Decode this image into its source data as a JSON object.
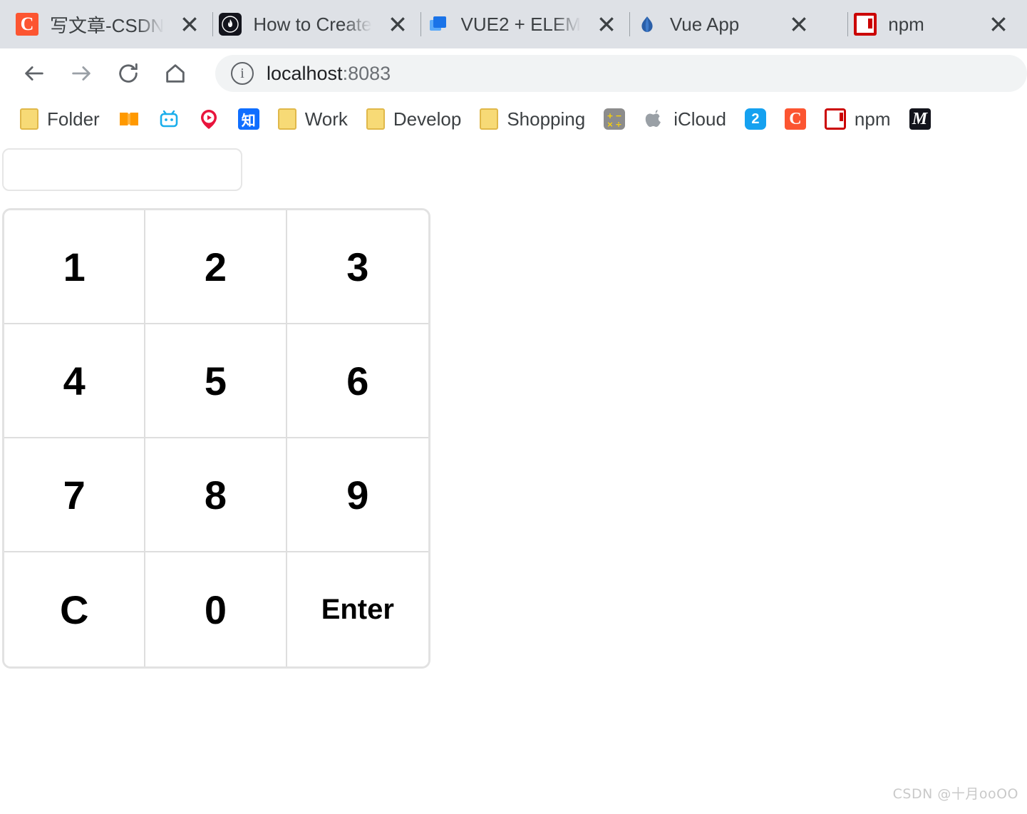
{
  "browser": {
    "tabs": [
      {
        "title": "写文章-CSDN",
        "icon": "csdn-icon",
        "truncated": true,
        "close_label": "×"
      },
      {
        "title": "How to Create",
        "icon": "dark-flame-icon",
        "truncated": true,
        "close_label": "×"
      },
      {
        "title": "VUE2 + ELEM",
        "icon": "blue-squares-icon",
        "truncated": true,
        "close_label": "×"
      },
      {
        "title": "Vue App",
        "icon": "vue-icon",
        "truncated": false,
        "close_label": "×"
      },
      {
        "title": "npm",
        "icon": "npm-icon",
        "truncated": false,
        "close_label": "×"
      }
    ],
    "overflow_tab_icon": "baidu-icon",
    "toolbar": {
      "back_icon": "back-arrow-icon",
      "forward_icon": "forward-arrow-icon",
      "reload_icon": "reload-icon",
      "home_icon": "home-icon",
      "site_info_icon": "info-circle-icon",
      "url_host": "localhost",
      "url_port": ":8083"
    },
    "bookmarks": [
      {
        "label": "Folder",
        "icon": "folder-icon",
        "icon_class": "ico-folder",
        "glyph": ""
      },
      {
        "label": "",
        "icon": "book-icon",
        "icon_class": "ico-book",
        "glyph": ""
      },
      {
        "label": "",
        "icon": "bilibili-icon",
        "icon_class": "ico-bili",
        "glyph": ""
      },
      {
        "label": "",
        "icon": "video-pin-icon",
        "icon_class": "ico-pin",
        "glyph": ""
      },
      {
        "label": "",
        "icon": "zhihu-icon",
        "icon_class": "ico-zhihu",
        "glyph": "知"
      },
      {
        "label": "Work",
        "icon": "folder-icon",
        "icon_class": "ico-folder",
        "glyph": ""
      },
      {
        "label": "Develop",
        "icon": "folder-icon",
        "icon_class": "ico-folder",
        "glyph": ""
      },
      {
        "label": "Shopping",
        "icon": "folder-icon",
        "icon_class": "ico-folder",
        "glyph": ""
      },
      {
        "label": "",
        "icon": "calculator-icon",
        "icon_class": "ico-calc",
        "glyph": ""
      },
      {
        "label": "iCloud",
        "icon": "apple-icon",
        "icon_class": "ico-apple",
        "glyph": ""
      },
      {
        "label": "",
        "icon": "blue-2-icon",
        "icon_class": "ico-blue2",
        "glyph": "2"
      },
      {
        "label": "",
        "icon": "csdn-icon",
        "icon_class": "ico-csdn",
        "glyph": "C"
      },
      {
        "label": "npm",
        "icon": "npm-icon",
        "icon_class": "ico-npm",
        "glyph": ""
      },
      {
        "label": "",
        "icon": "dark-italic-icon",
        "icon_class": "ico-edge",
        "glyph": "M"
      }
    ]
  },
  "app": {
    "input": {
      "value": "",
      "placeholder": ""
    },
    "keypad": {
      "keys": [
        {
          "label": "1",
          "name": "key-1"
        },
        {
          "label": "2",
          "name": "key-2"
        },
        {
          "label": "3",
          "name": "key-3"
        },
        {
          "label": "4",
          "name": "key-4"
        },
        {
          "label": "5",
          "name": "key-5"
        },
        {
          "label": "6",
          "name": "key-6"
        },
        {
          "label": "7",
          "name": "key-7"
        },
        {
          "label": "8",
          "name": "key-8"
        },
        {
          "label": "9",
          "name": "key-9"
        },
        {
          "label": "C",
          "name": "key-clear"
        },
        {
          "label": "0",
          "name": "key-0"
        },
        {
          "label": "Enter",
          "name": "key-enter"
        }
      ]
    },
    "watermark": "CSDN @十月ooOO"
  },
  "colors": {
    "tabstrip_bg": "#dee1e6",
    "omnibox_bg": "#f1f3f4",
    "key_border": "#dedede",
    "csdn_red": "#fc5531",
    "npm_red": "#cb0000"
  }
}
